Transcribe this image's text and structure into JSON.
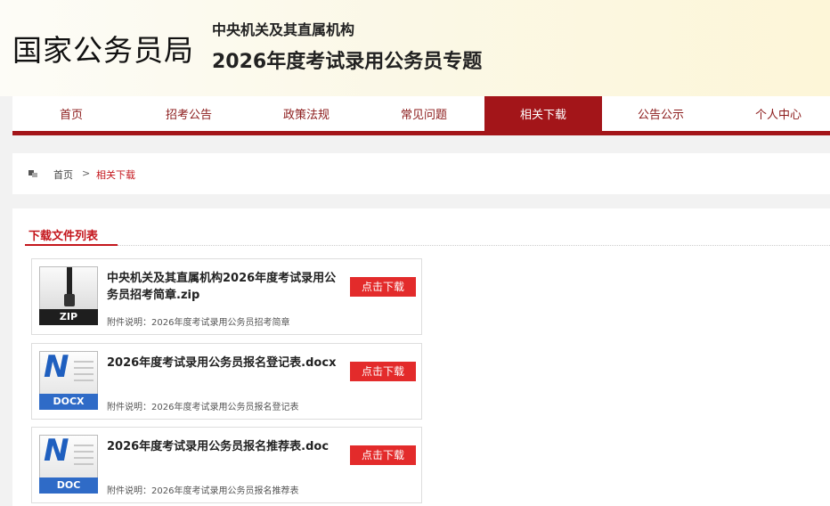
{
  "header": {
    "site_title": "国家公务员局",
    "org_line": "中央机关及其直属机构",
    "topic_line": "2026年度考试录用公务员专题"
  },
  "nav": {
    "items": [
      {
        "label": "首页",
        "active": false
      },
      {
        "label": "招考公告",
        "active": false
      },
      {
        "label": "政策法规",
        "active": false
      },
      {
        "label": "常见问题",
        "active": false
      },
      {
        "label": "相关下载",
        "active": true
      },
      {
        "label": "公告公示",
        "active": false
      },
      {
        "label": "个人中心",
        "active": false
      }
    ]
  },
  "breadcrumb": {
    "home": "首页",
    "separator": ">",
    "current": "相关下载"
  },
  "content": {
    "section_title": "下载文件列表",
    "download_label": "点击下载",
    "files": [
      {
        "name": "中央机关及其直属机构2026年度考试录用公务员招考简章.zip",
        "type_label": "ZIP",
        "icon": "zip-file-icon",
        "description": "附件说明：2026年度考试录用公务员招考简章"
      },
      {
        "name": "2026年度考试录用公务员报名登记表.docx",
        "type_label": "DOCX",
        "icon": "word-file-icon",
        "description": "附件说明：2026年度考试录用公务员报名登记表"
      },
      {
        "name": "2026年度考试录用公务员报名推荐表.doc",
        "type_label": "DOC",
        "icon": "word-file-icon",
        "description": "附件说明：2026年度考试录用公务员报名推荐表"
      }
    ]
  },
  "colors": {
    "brand_red": "#a31519",
    "accent_red": "#c4161c",
    "button_red": "#e32b2b",
    "word_blue": "#2f6bc7"
  }
}
